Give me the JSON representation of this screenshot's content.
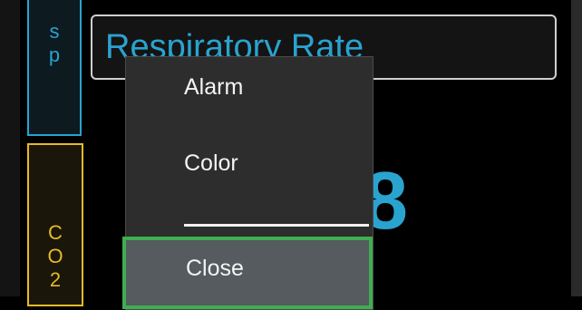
{
  "tabs": {
    "spo2": {
      "letters": [
        "s",
        "p"
      ]
    },
    "co2": {
      "letters": [
        "C",
        "O",
        "2"
      ]
    }
  },
  "rr_panel": {
    "title": "Respiratory Rate",
    "value_partial": "8"
  },
  "context_menu": {
    "items": [
      {
        "label": "Alarm"
      },
      {
        "label": "Color"
      },
      {
        "label": "Close",
        "selected": true
      }
    ]
  },
  "colors": {
    "spo2_accent": "#2aa3cf",
    "co2_accent": "#e5b92a",
    "selection_border": "#3fae4f"
  }
}
